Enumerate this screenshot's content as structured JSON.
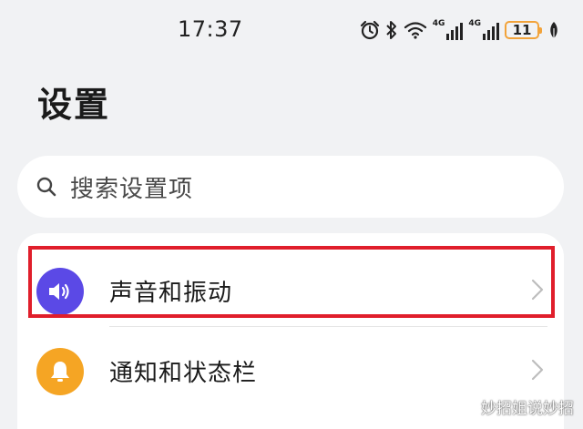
{
  "status_bar": {
    "time": "17:37",
    "battery_level": "11",
    "signal_1_label": "4G",
    "signal_2_label": "4G",
    "icons": [
      "alarm-icon",
      "bluetooth-icon",
      "wifi-icon",
      "signal-icon",
      "signal-icon",
      "battery-icon",
      "leaf-icon"
    ],
    "battery_color": "#f2a33a"
  },
  "page": {
    "title": "设置"
  },
  "search": {
    "placeholder": "搜索设置项"
  },
  "settings_list": [
    {
      "label": "声音和振动",
      "icon": "speaker-icon",
      "icon_color": "#5b49e6",
      "highlighted": true
    },
    {
      "label": "通知和状态栏",
      "icon": "bell-icon",
      "icon_color": "#f5a524",
      "highlighted": false
    }
  ],
  "highlight_color": "#e01e2b",
  "watermark": {
    "text": "妙招姐说妙招",
    "icon": "paw-icon"
  }
}
